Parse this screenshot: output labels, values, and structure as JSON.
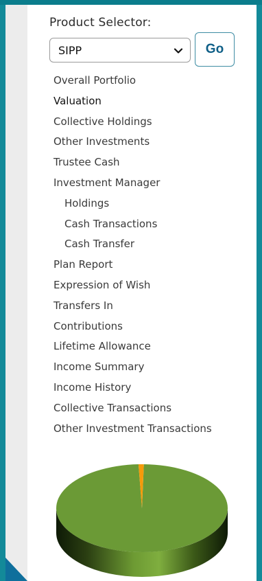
{
  "product_selector": {
    "label": "Product Selector:",
    "selected_value": "SIPP",
    "go_label": "Go"
  },
  "nav": {
    "items": [
      {
        "label": "Overall Portfolio"
      },
      {
        "label": "Valuation",
        "active": true
      },
      {
        "label": "Collective Holdings"
      },
      {
        "label": "Other Investments"
      },
      {
        "label": "Trustee Cash"
      },
      {
        "label": "Investment Manager"
      },
      {
        "label": "Holdings",
        "indent": true
      },
      {
        "label": "Cash Transactions",
        "indent": true
      },
      {
        "label": "Cash Transfer",
        "indent": true
      },
      {
        "label": "Plan Report"
      },
      {
        "label": "Expression of Wish"
      },
      {
        "label": "Transfers In"
      },
      {
        "label": "Contributions"
      },
      {
        "label": "Lifetime Allowance"
      },
      {
        "label": "Income Summary"
      },
      {
        "label": "Income History"
      },
      {
        "label": "Collective Transactions"
      },
      {
        "label": "Other Investment Transactions"
      }
    ]
  },
  "colors": {
    "frame": "#138a99",
    "pie_main": "#6b9a36",
    "pie_slice": "#f59a0a",
    "go_text": "#0f5f87"
  },
  "chart_data": {
    "type": "pie",
    "slices": [
      {
        "value": 99,
        "color": "#6b9a36"
      },
      {
        "value": 1,
        "color": "#f59a0a"
      }
    ]
  }
}
